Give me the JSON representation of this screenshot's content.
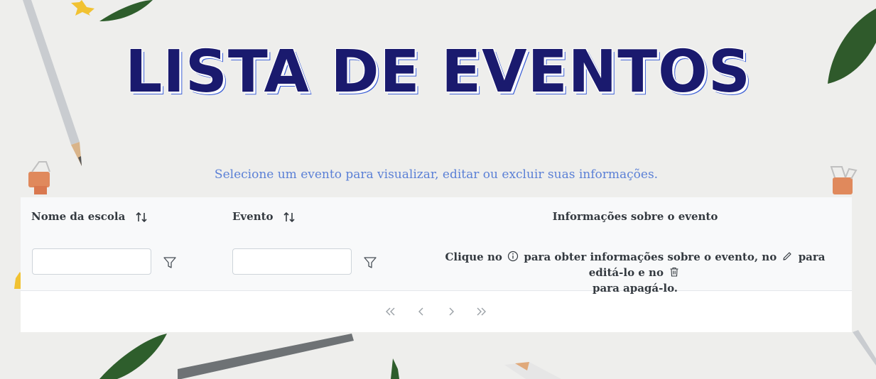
{
  "page": {
    "title": "LISTA DE EVENTOS",
    "subtitle": "Selecione um evento para visualizar, editar ou excluir suas informações."
  },
  "table": {
    "columns": [
      {
        "label": "Nome da escola",
        "sortable": true
      },
      {
        "label": "Evento",
        "sortable": true
      },
      {
        "label": "Informações sobre o evento",
        "sortable": false
      }
    ],
    "filters": {
      "school_name_value": "",
      "event_value": ""
    },
    "info": {
      "part1": "Clique no",
      "part2": "para obter informações sobre o evento, no",
      "part3": "para editá-lo e no",
      "part4": "para apagá-lo."
    }
  },
  "icons": {
    "sort": "sort-alt-icon",
    "filter": "filter-icon",
    "info": "info-circle-icon",
    "edit": "pencil-icon",
    "delete": "trash-icon",
    "first": "angle-double-left-icon",
    "prev": "angle-left-icon",
    "next": "angle-right-icon",
    "last": "angle-double-right-icon"
  },
  "colors": {
    "title": "#1a1a6e",
    "title_shadow": "#3c5fd6",
    "subtitle": "#5b80d6"
  }
}
